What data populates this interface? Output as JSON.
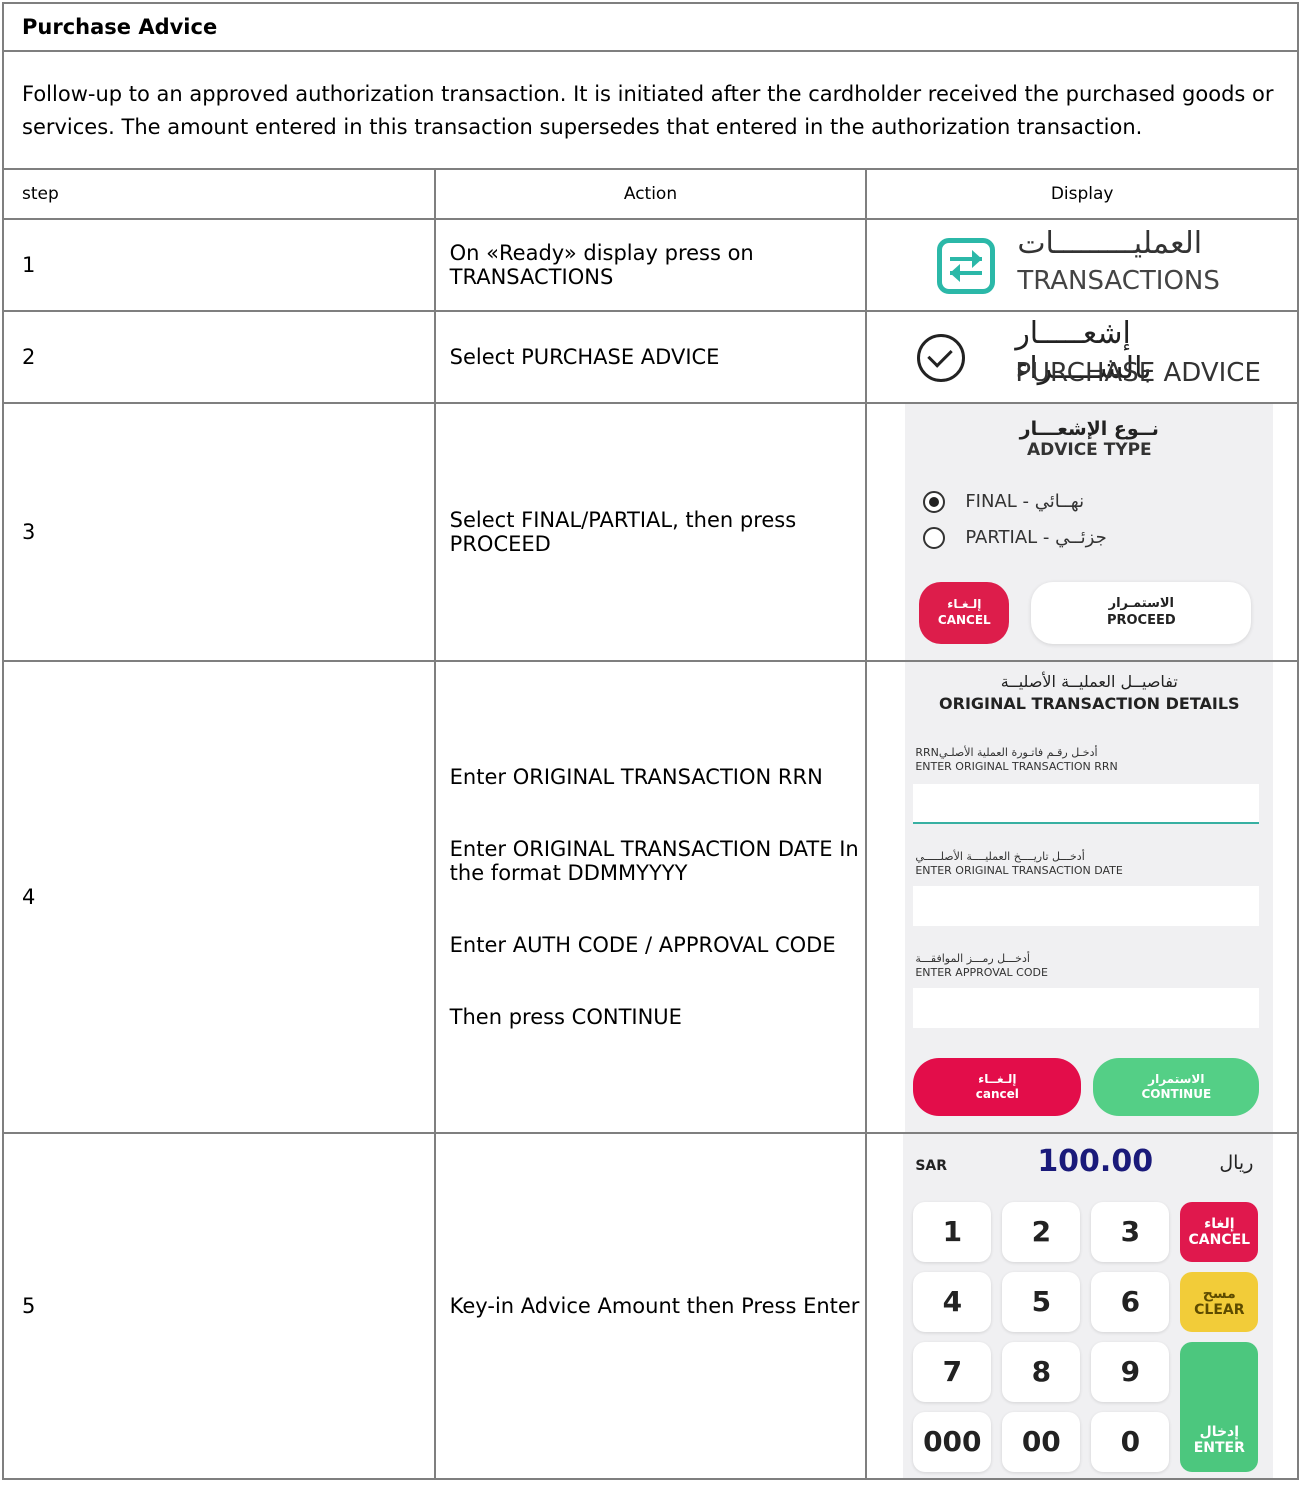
{
  "title": "Purchase Advice",
  "description": "Follow-up to an approved authorization transaction. It is initiated after the cardholder received the purchased goods or services. The amount entered in this transaction supersedes that entered in the authorization transaction.",
  "headers": {
    "step": "step",
    "action": "Action",
    "display": "Display"
  },
  "rows": [
    {
      "step": "1",
      "action": "On «Ready» display press on TRANSACTIONS"
    },
    {
      "step": "2",
      "action": "Select PURCHASE ADVICE"
    },
    {
      "step": "3",
      "action": "Select FINAL/PARTIAL, then press PROCEED"
    },
    {
      "step": "4",
      "actions": [
        "Enter ORIGINAL TRANSACTION RRN",
        "Enter ORIGINAL TRANSACTION DATE In the format DDMMYYYY",
        "Enter AUTH CODE / APPROVAL CODE",
        "Then press CONTINUE"
      ]
    },
    {
      "step": "5",
      "action": "Key-in Advice Amount then Press Enter"
    }
  ],
  "display1": {
    "icon": "transactions-icon",
    "arabic": "العمليـــــــــات",
    "english": "TRANSACTIONS",
    "color": "#2bb8a8"
  },
  "display2": {
    "icon": "check-circle-icon",
    "arabic": "إشعـــــار بالشـــــراء",
    "english": "PURCHASE ADVICE"
  },
  "display3": {
    "title_ar": "نــوع الإشعـــار",
    "title_en": "ADVICE TYPE",
    "option_final": "FINAL - نهــائي",
    "option_partial": "PARTIAL - جزئــي",
    "selected": "FINAL",
    "cancel_ar": "إلـغـاء",
    "cancel_en": "CANCEL",
    "proceed_ar": "الاستمـرار",
    "proceed_en": "PROCEED"
  },
  "display4": {
    "title_ar": "تفاصيــل العمليــة الأصليــة",
    "title_en": "ORIGINAL TRANSACTION DETAILS",
    "rrn_ar": "أدخـل رقـم فاتـورة العملية الأصلـيRRN",
    "rrn_en": "ENTER ORIGINAL TRANSACTION RRN",
    "date_ar": "أدخـــل تاريــــخ العمليــــة الأصلـــــي",
    "date_en": "ENTER ORIGINAL TRANSACTION DATE",
    "code_ar": "أدخـــل رمـــز الموافقـــة",
    "code_en": "ENTER APPROVAL CODE",
    "cancel_ar": "إلـغــاء",
    "cancel_en": "cancel",
    "continue_ar": "الاستمرار",
    "continue_en": "CONTINUE"
  },
  "display5": {
    "currency_en": "SAR",
    "amount": "100.00",
    "currency_ar": "ريال",
    "keys": [
      "1",
      "2",
      "3",
      "4",
      "5",
      "6",
      "7",
      "8",
      "9",
      "000",
      "00",
      "0"
    ],
    "cancel_ar": "إلغاء",
    "cancel_en": "CANCEL",
    "clear_ar": "مسح",
    "clear_en": "CLEAR",
    "enter_ar": "إدخال",
    "enter_en": "ENTER"
  }
}
